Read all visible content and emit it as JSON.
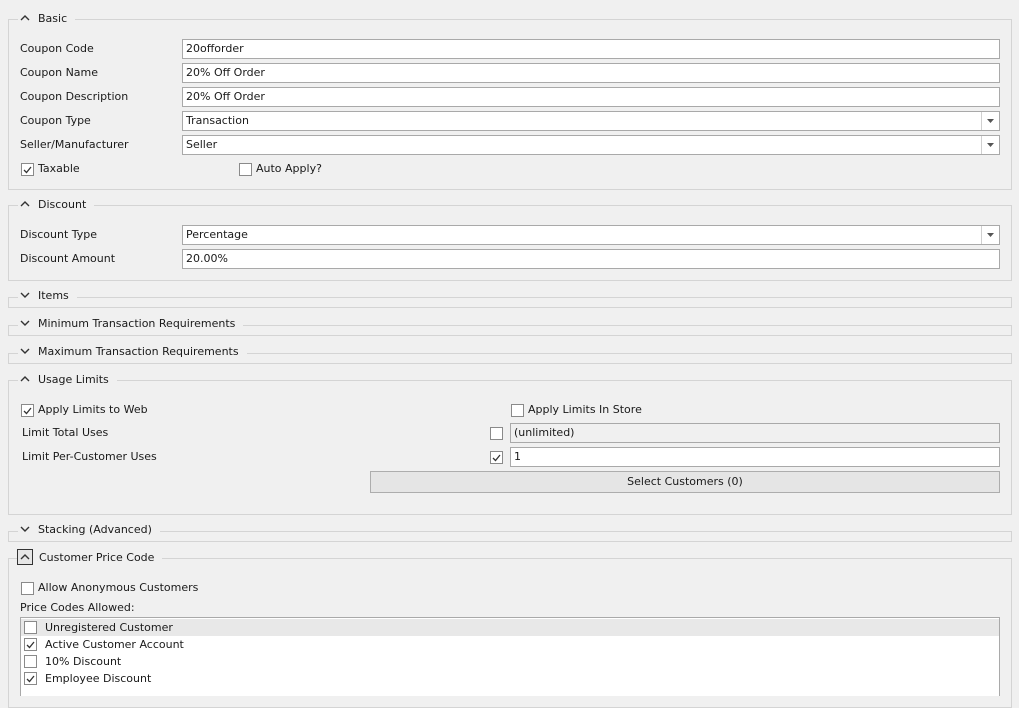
{
  "sections": {
    "basic": "Basic",
    "discount": "Discount",
    "items": "Items",
    "min_req": "Minimum Transaction Requirements",
    "max_req": "Maximum Transaction Requirements",
    "usage": "Usage Limits",
    "stacking": "Stacking (Advanced)",
    "price_code": "Customer Price Code"
  },
  "basic": {
    "coupon_code_label": "Coupon Code",
    "coupon_code_value": "20offorder",
    "coupon_name_label": "Coupon Name",
    "coupon_name_value": "20% Off Order",
    "coupon_desc_label": "Coupon Description",
    "coupon_desc_value": "20% Off Order",
    "coupon_type_label": "Coupon Type",
    "coupon_type_value": "Transaction",
    "seller_label": "Seller/Manufacturer",
    "seller_value": "Seller",
    "taxable_label": "Taxable",
    "taxable_checked": true,
    "auto_apply_label": "Auto Apply?",
    "auto_apply_checked": false
  },
  "discount": {
    "type_label": "Discount Type",
    "type_value": "Percentage",
    "amount_label": "Discount Amount",
    "amount_value": "20.00%"
  },
  "usage": {
    "apply_web_label": "Apply Limits to Web",
    "apply_web_checked": true,
    "apply_store_label": "Apply Limits In Store",
    "apply_store_checked": false,
    "limit_total_label": "Limit Total Uses",
    "limit_total_checked": false,
    "limit_total_value": "(unlimited)",
    "limit_per_customer_label": "Limit Per-Customer Uses",
    "limit_per_customer_checked": true,
    "limit_per_customer_value": "1",
    "select_customers_label": "Select Customers (0)"
  },
  "price_code": {
    "allow_anon_label": "Allow Anonymous Customers",
    "allow_anon_checked": false,
    "allowed_label": "Price Codes Allowed:",
    "items": [
      {
        "label": "Unregistered Customer",
        "checked": false
      },
      {
        "label": "Active Customer Account",
        "checked": true
      },
      {
        "label": "10% Discount",
        "checked": false
      },
      {
        "label": "Employee Discount",
        "checked": true
      }
    ]
  },
  "icons": {
    "expanded": "chevron-up-icon",
    "collapsed": "chevron-down-icon",
    "dropdown": "dropdown-arrow-icon",
    "check": "checkmark-icon"
  }
}
